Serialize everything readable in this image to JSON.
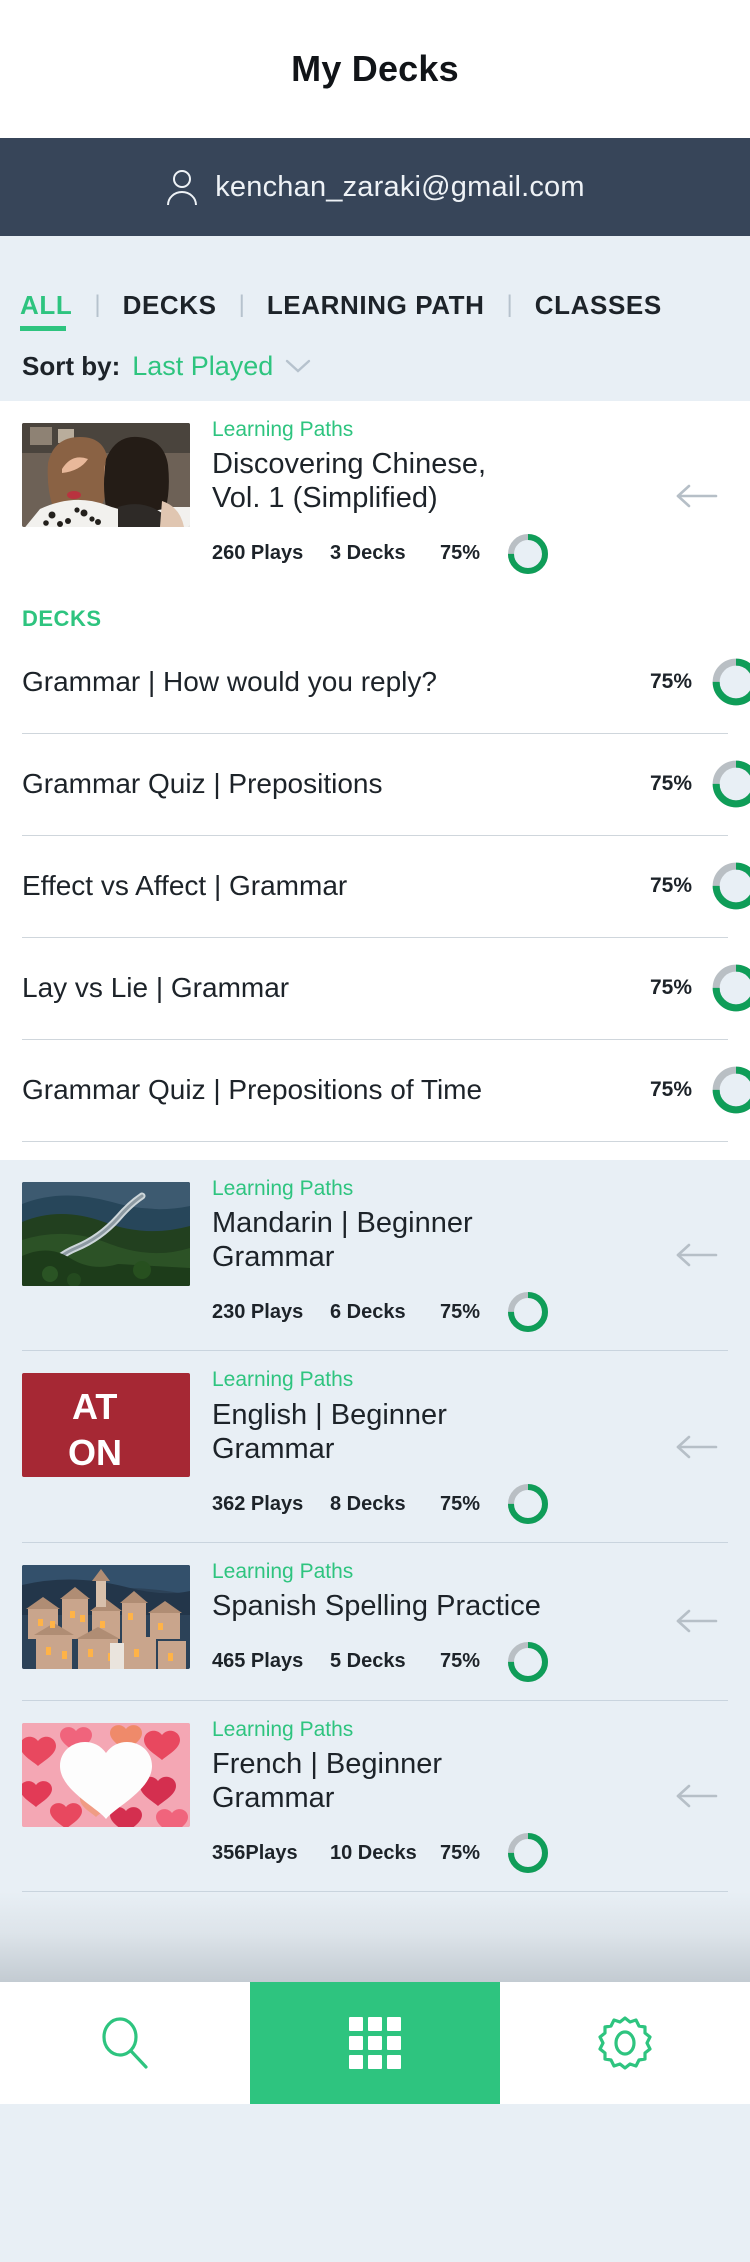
{
  "header": {
    "title": "My Decks",
    "account_email": "kenchan_zaraki@gmail.com",
    "person_icon": "person-icon"
  },
  "tabs": [
    {
      "label": "ALL",
      "active": true
    },
    {
      "label": "DECKS",
      "active": false
    },
    {
      "label": "LEARNING PATH",
      "active": false
    },
    {
      "label": "CLASSES",
      "active": false
    }
  ],
  "sort": {
    "label": "Sort by:",
    "value": "Last Played",
    "chevron_icon": "chevron-down-icon"
  },
  "featured_path": {
    "kicker": "Learning Paths",
    "title": "Discovering Chinese, Vol. 1 (Simplified)",
    "plays": "260 Plays",
    "decks": "3 Decks",
    "percent": "75%",
    "progress": 75,
    "arrow_icon": "arrow-left-icon",
    "thumbnail": "two-women-laughing-photo"
  },
  "decks_section": {
    "heading": "DECKS",
    "items": [
      {
        "name": "Grammar | How would you reply?",
        "percent": "75%",
        "progress": 75
      },
      {
        "name": "Grammar Quiz | Prepositions",
        "percent": "75%",
        "progress": 75
      },
      {
        "name": "Effect vs Affect | Grammar",
        "percent": "75%",
        "progress": 75
      },
      {
        "name": "Lay vs Lie | Grammar",
        "percent": "75%",
        "progress": 75
      },
      {
        "name": "Grammar Quiz | Prepositions of Time",
        "percent": "75%",
        "progress": 75
      }
    ]
  },
  "paths": [
    {
      "kicker": "Learning Paths",
      "title": "Mandarin | Beginner Grammar",
      "plays": "230 Plays",
      "decks": "6 Decks",
      "percent": "75%",
      "progress": 75,
      "arrow_icon": "arrow-left-icon",
      "thumbnail": "great-wall-mountains-photo"
    },
    {
      "kicker": "Learning Paths",
      "title": "English | Beginner Grammar",
      "plays": "362 Plays",
      "decks": "8 Decks",
      "percent": "75%",
      "progress": 75,
      "arrow_icon": "arrow-left-icon",
      "thumbnail": "at-on-red-card",
      "thumb_text_1": "AT",
      "thumb_text_2": "ON"
    },
    {
      "kicker": "Learning Paths",
      "title": "Spanish Spelling Practice",
      "plays": "465 Plays",
      "decks": "5 Decks",
      "percent": "75%",
      "progress": 75,
      "arrow_icon": "arrow-left-icon",
      "thumbnail": "spanish-village-dusk-photo"
    },
    {
      "kicker": "Learning Paths",
      "title": "French | Beginner Grammar",
      "plays": "356Plays",
      "decks": "10 Decks",
      "percent": "75%",
      "progress": 75,
      "arrow_icon": "arrow-left-icon",
      "thumbnail": "white-heart-on-pink-hearts-photo"
    }
  ],
  "bottom_nav": [
    {
      "icon": "search-icon",
      "active": false
    },
    {
      "icon": "grid-icon",
      "active": true
    },
    {
      "icon": "gear-icon",
      "active": false
    }
  ],
  "colors": {
    "accent_green": "#2ec47f",
    "header_navy": "#374559",
    "page_bg": "#e8eff5",
    "card_white": "#ffffff",
    "text_dark": "#1d2329",
    "ring_track": "#b9bfc4",
    "thumb_red": "#a62834"
  }
}
